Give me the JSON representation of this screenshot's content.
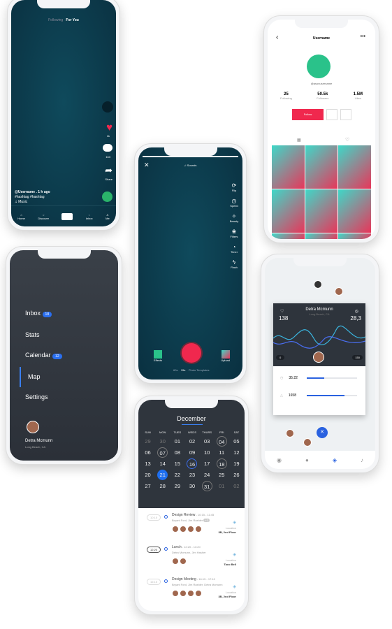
{
  "feed": {
    "tabs": [
      "Following",
      "For You"
    ],
    "likes": "1k",
    "comments": "163",
    "share": "Share",
    "username": "@Username . 1 h ago",
    "hashtags": "#hashtag  #hashtag",
    "music": "♫ Music",
    "nav": [
      "Home",
      "Discover",
      "",
      "Inbox",
      "Me"
    ]
  },
  "profile": {
    "title": "Username",
    "handle": "@asonusername",
    "stats": [
      {
        "value": "25",
        "label": "Following"
      },
      {
        "value": "50.5k",
        "label": "Followers"
      },
      {
        "value": "1.5M",
        "label": "Likes"
      }
    ],
    "follow": "Follow",
    "accent": "#f0284e",
    "avatar_color": "#2ac28a"
  },
  "camera": {
    "sounds": "♫ Sounds",
    "tools": [
      "Flip",
      "Speed",
      "Beauty",
      "Filters",
      "Timer",
      "Flash"
    ],
    "effects": "Effects",
    "upload": "Upload",
    "modes": [
      "60s",
      "15s",
      "Photo Templates"
    ],
    "record_color": "#f0284e"
  },
  "menu": {
    "items": [
      {
        "label": "Inbox",
        "badge": "18"
      },
      {
        "label": "Stats"
      },
      {
        "label": "Calendar",
        "badge": "12"
      },
      {
        "label": "Map"
      },
      {
        "label": "Settings"
      }
    ],
    "user": "Detra Mcmunn",
    "location": "Long Beach, CA"
  },
  "map": {
    "name": "Detra Mcmunn",
    "location": "Long Beach, CA",
    "left_value": "138",
    "right_value": "28,3",
    "range_min": "0",
    "range_max": "150",
    "rows": [
      {
        "value": "35:22",
        "progress": 0.35
      },
      {
        "value": "1658",
        "progress": 0.75
      }
    ]
  },
  "calendar": {
    "month": "December",
    "days": [
      "SUN",
      "MON",
      "TUES",
      "WEDS",
      "THURS",
      "FRI",
      "SAT"
    ],
    "weeks": [
      [
        "29",
        "30",
        "01",
        "02",
        "03",
        "04",
        "05"
      ],
      [
        "06",
        "07",
        "08",
        "09",
        "10",
        "11",
        "12"
      ],
      [
        "13",
        "14",
        "15",
        "16",
        "17",
        "18",
        "19"
      ],
      [
        "20",
        "21",
        "22",
        "23",
        "24",
        "25",
        "26"
      ],
      [
        "27",
        "28",
        "29",
        "30",
        "31",
        "01",
        "02"
      ]
    ],
    "events": [
      {
        "time": "10:15",
        "title": "Design Review",
        "span": " - 10:15 - 11:45",
        "people": "Bryant Ford, Jim Rashler",
        "tag": "+2",
        "loc_label": "Location",
        "loc": "3B, 2nd Floor"
      },
      {
        "time": "12:20",
        "title": "Lunch",
        "span": " - 12:20 - 13:20",
        "people": "Detra Mcmunn, Jim Hasher",
        "loc_label": "Location",
        "loc": "Taco Bell"
      },
      {
        "time": "16:15",
        "title": "Design Meeting",
        "span": " - 16:15 - 17:10",
        "people": "Bryant Ford, Jim Rashler, Detra Mcmunn",
        "loc_label": "Location",
        "loc": "3B, 2nd Floor"
      }
    ]
  }
}
